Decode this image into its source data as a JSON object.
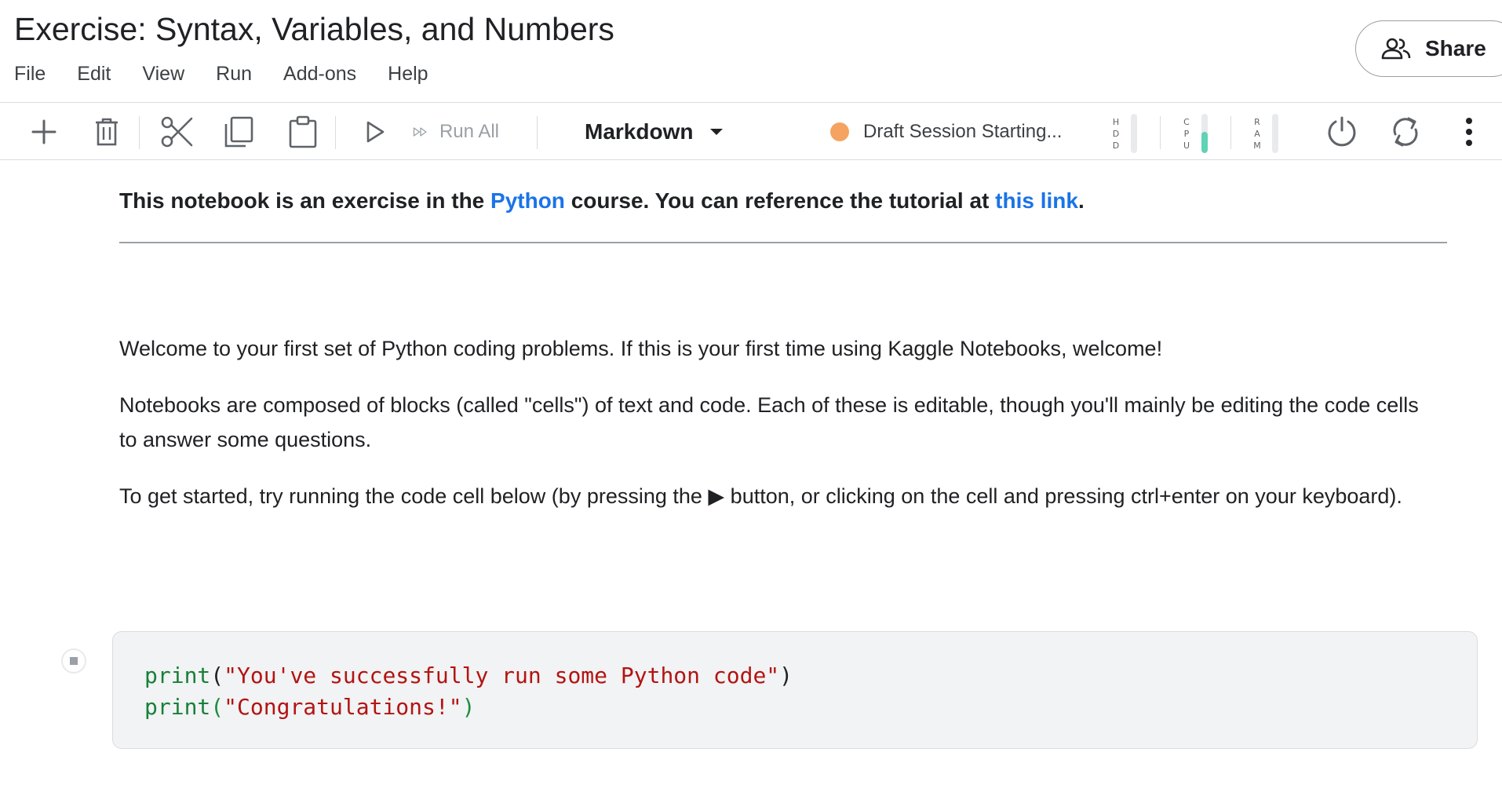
{
  "header": {
    "title": "Exercise: Syntax, Variables, and Numbers",
    "menu": [
      "File",
      "Edit",
      "View",
      "Run",
      "Add-ons",
      "Help"
    ],
    "share_label": "Share"
  },
  "toolbar": {
    "icons": [
      "plus-icon",
      "trash-icon",
      "scissors-icon",
      "copy-icon",
      "paste-icon",
      "play-icon",
      "fast-forward-icon",
      "power-icon",
      "refresh-icon",
      "more-vertical-icon"
    ],
    "run_all_label": "Run All",
    "cell_type": "Markdown",
    "session_status": "Draft Session Starting...",
    "session_color": "#f4a460",
    "meters": [
      {
        "label": "HDD",
        "fill": 0.0,
        "color": "#e8eaed"
      },
      {
        "label": "CPU",
        "fill": 0.55,
        "color": "#5fd3b3"
      },
      {
        "label": "RAM",
        "fill": 0.0,
        "color": "#e8eaed"
      }
    ]
  },
  "content": {
    "intro_prefix": "This notebook is an exercise in the ",
    "intro_link1": "Python",
    "intro_middle": " course. You can reference the tutorial at ",
    "intro_link2": "this link",
    "intro_suffix": ".",
    "para1": "Welcome to your first set of Python coding problems. If this is your first time using Kaggle Notebooks, welcome!",
    "para2": "Notebooks are composed of blocks (called \"cells\") of text and code. Each of these is editable, though you'll mainly be editing the code cells to answer some questions.",
    "para3": "To get started, try running the code cell below (by pressing the ▶ button, or clicking on the cell and pressing ctrl+enter on your keyboard)."
  },
  "code_cell": {
    "line1_fn": "print",
    "line1_open": "(",
    "line1_str": "\"You've successfully run some Python code\"",
    "line1_close": ")",
    "line2_fn": "print",
    "line2_open": "(",
    "line2_str": "\"Congratulations!\"",
    "line2_close": ")"
  },
  "colors": {
    "link": "#1a73e8",
    "code_function": "#188038",
    "code_string": "#b31412"
  }
}
